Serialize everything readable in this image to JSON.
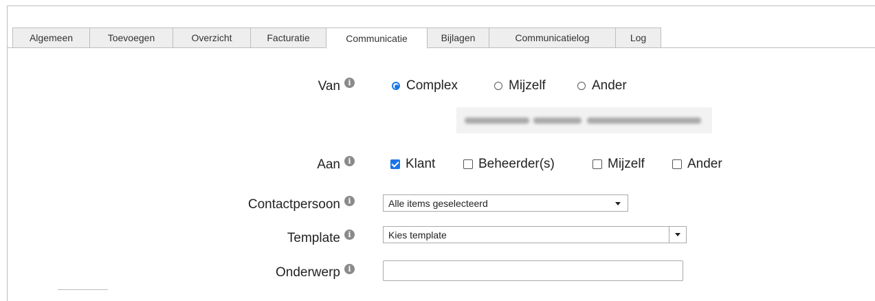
{
  "tabs": [
    {
      "label": "Algemeen",
      "active": false
    },
    {
      "label": "Toevoegen",
      "active": false
    },
    {
      "label": "Overzicht",
      "active": false
    },
    {
      "label": "Facturatie",
      "active": false
    },
    {
      "label": "Communicatie",
      "active": true
    },
    {
      "label": "Bijlagen",
      "active": false
    },
    {
      "label": "Communicatielog",
      "active": false
    },
    {
      "label": "Log",
      "active": false
    }
  ],
  "info_glyph": "i",
  "van": {
    "label": "Van",
    "options": [
      {
        "label": "Complex",
        "selected": true
      },
      {
        "label": "Mijzelf",
        "selected": false
      },
      {
        "label": "Ander",
        "selected": false
      }
    ]
  },
  "aan": {
    "label": "Aan",
    "options": [
      {
        "label": "Klant",
        "checked": true
      },
      {
        "label": "Beheerder(s)",
        "checked": false
      },
      {
        "label": "Mijzelf",
        "checked": false
      },
      {
        "label": "Ander",
        "checked": false
      }
    ]
  },
  "contactpersoon": {
    "label": "Contactpersoon",
    "value": "Alle items geselecteerd"
  },
  "template": {
    "label": "Template",
    "value": "Kies template"
  },
  "onderwerp": {
    "label": "Onderwerp",
    "value": ""
  },
  "colors": {
    "accent": "#1a73e8",
    "border": "#bdbdbd",
    "tab_bg": "#eeeeee"
  }
}
